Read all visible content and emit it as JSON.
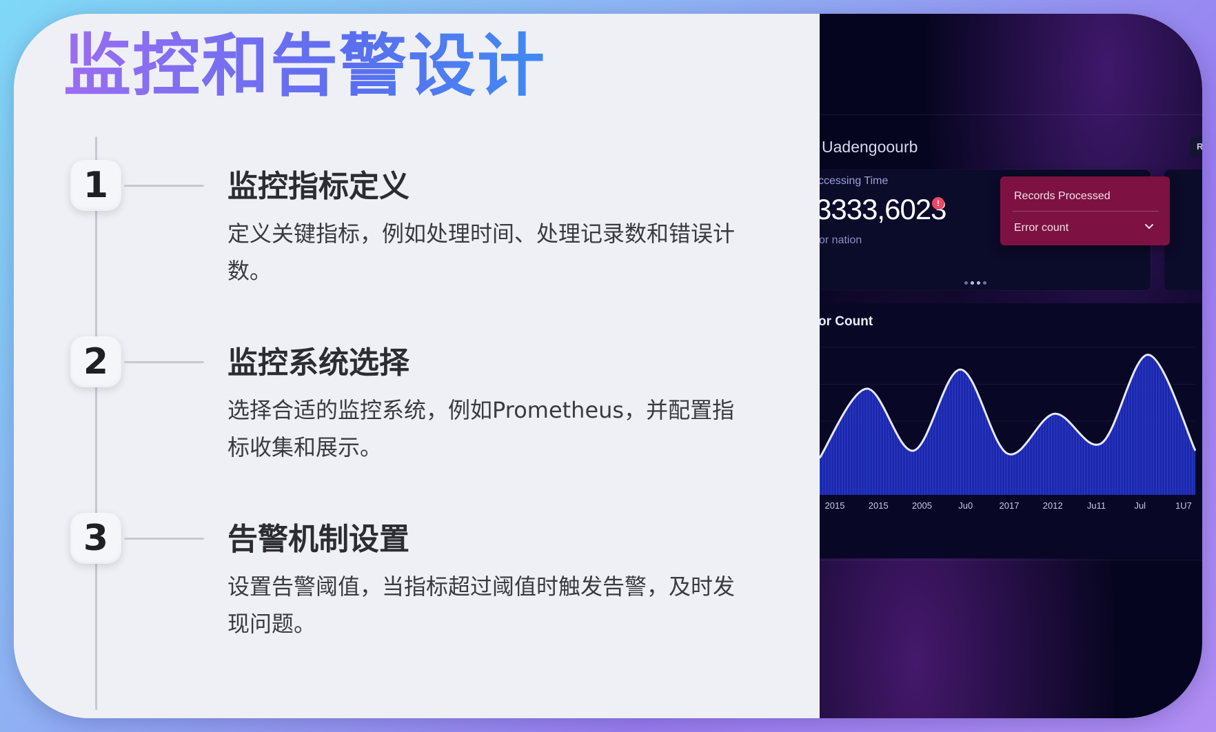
{
  "title": "监控和告警设计",
  "steps": [
    {
      "number": "1",
      "title": "监控指标定义",
      "desc": "定义关键指标，例如处理时间、处理记录数和错误计数。"
    },
    {
      "number": "2",
      "title": "监控系统选择",
      "desc": "选择合适的监控系统，例如Prometheus，并配置指标收集和展示。"
    },
    {
      "number": "3",
      "title": "告警机制设置",
      "desc": "设置告警阈值，当指标超过阈值时触发告警，及时发现问题。"
    }
  ],
  "dashboard": {
    "title": "Uadengoourb",
    "header_chip": "R",
    "metric_label": "ccessing Time",
    "metric_value": "3333,6023",
    "alert_badge": "!",
    "metric_sub": "or nation",
    "dropdown": {
      "item1": "Records Processed",
      "item2": "Error count"
    },
    "chart_title": "or Count",
    "colors": {
      "background": "#06051f",
      "dropdown": "#7d1242",
      "area": "#1c2ab3",
      "line": "#e8e8ff"
    }
  },
  "chart_data": {
    "type": "area",
    "title": "",
    "categories": [
      "2015",
      "2015",
      "2005",
      "Ju0",
      "2017",
      "2012",
      "Ju11",
      "Jul",
      "1U7"
    ],
    "series": [
      {
        "values": [
          0.25,
          0.72,
          0.3,
          0.85,
          0.28,
          0.55,
          0.35,
          0.95,
          0.3
        ]
      }
    ],
    "xlabel": "",
    "ylabel": "",
    "grid": true
  }
}
